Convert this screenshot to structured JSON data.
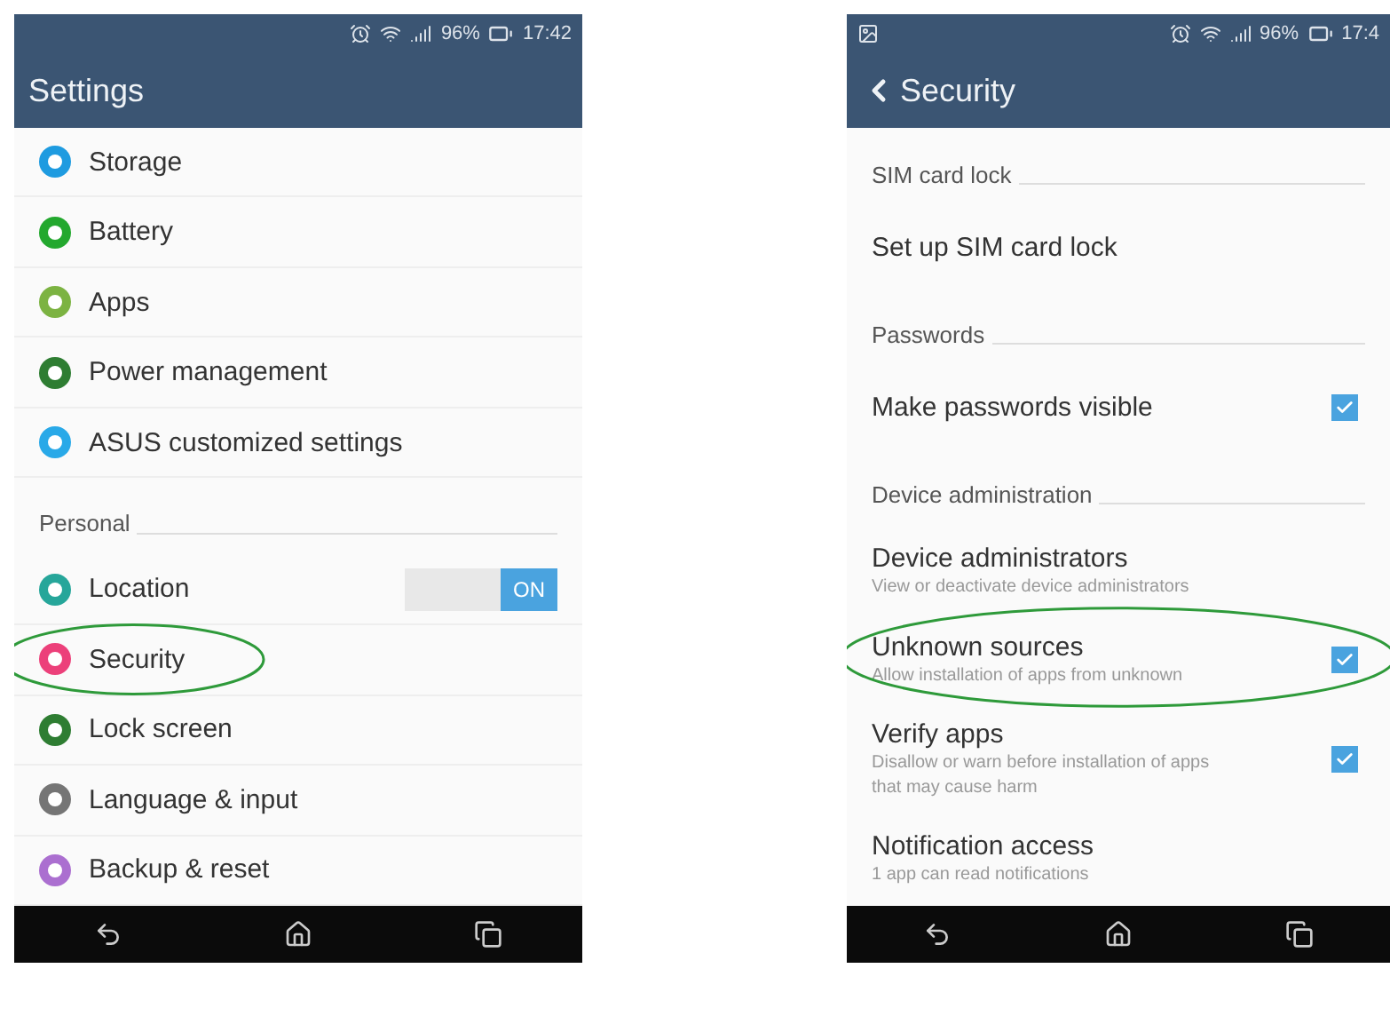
{
  "screens": [
    {
      "status_bar": {
        "battery": "96%",
        "time": "17:42"
      },
      "title": "Settings",
      "items": [
        {
          "kind": "setting",
          "label": "Storage",
          "color": "#1e9be0"
        },
        {
          "kind": "setting",
          "label": "Battery",
          "color": "#23a82e"
        },
        {
          "kind": "setting",
          "label": "Apps",
          "color": "#7cb342"
        },
        {
          "kind": "setting",
          "label": "Power management",
          "color": "#2e7d32"
        },
        {
          "kind": "setting",
          "label": "ASUS customized settings",
          "color": "#29a9e8"
        },
        {
          "kind": "header",
          "label": "Personal"
        },
        {
          "kind": "toggle",
          "label": "Location",
          "color": "#26a69a",
          "on": true,
          "toggle_label": "ON"
        },
        {
          "kind": "setting",
          "label": "Security",
          "color": "#ec407a",
          "highlighted": true
        },
        {
          "kind": "setting",
          "label": "Lock screen",
          "color": "#2e7d32"
        },
        {
          "kind": "setting",
          "label": "Language & input",
          "color": "#757575"
        },
        {
          "kind": "setting",
          "label": "Backup & reset",
          "color": "#ab6fd0"
        }
      ]
    },
    {
      "status_bar": {
        "notification": true,
        "battery": "96%",
        "time": "17:4"
      },
      "title": "Security",
      "back": true,
      "items": [
        {
          "kind": "header",
          "label": "SIM card lock"
        },
        {
          "kind": "plain",
          "label": "Set up SIM card lock"
        },
        {
          "kind": "header",
          "label": "Passwords"
        },
        {
          "kind": "checkbox",
          "label": "Make passwords visible",
          "checked": true
        },
        {
          "kind": "header",
          "label": "Device administration"
        },
        {
          "kind": "plain",
          "label": "Device administrators",
          "summary": "View or deactivate device administrators"
        },
        {
          "kind": "checkbox",
          "label": "Unknown sources",
          "summary": "Allow installation of apps from unknown",
          "checked": true,
          "highlighted": true
        },
        {
          "kind": "checkbox",
          "label": "Verify apps",
          "summary": "Disallow or warn before installation of apps that may cause harm",
          "checked": true
        },
        {
          "kind": "plain",
          "label": "Notification access",
          "summary": "1 app can read notifications"
        }
      ]
    }
  ]
}
